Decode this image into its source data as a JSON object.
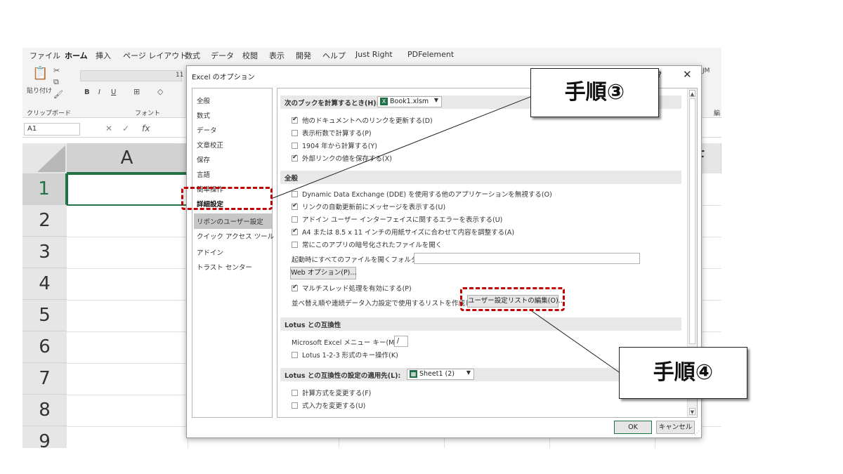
{
  "excel": {
    "menu": [
      "ファイル",
      "ホーム",
      "挿入",
      "ページ レイアウト",
      "数式",
      "データ",
      "校閲",
      "表示",
      "開発",
      "ヘルプ",
      "Just Right",
      "PDFelement"
    ],
    "active_menu": "ホーム",
    "ribbon": {
      "paste_label": "貼り付け",
      "clipboard_group": "クリップボード",
      "font_group": "フォント",
      "font_size": "11",
      "bold": "B",
      "italic": "I",
      "underline": "U",
      "right_cut_label": "JM",
      "right_group": "編"
    },
    "name_box": "A1",
    "fx": "fx",
    "columns": [
      "A",
      "F"
    ],
    "rows": [
      "1",
      "2",
      "3",
      "4",
      "5",
      "6",
      "7",
      "8",
      "9"
    ]
  },
  "dialog": {
    "title": "Excel のオプション",
    "help": "?",
    "close": "✕",
    "nav": [
      "全般",
      "数式",
      "データ",
      "文章校正",
      "保存",
      "言語",
      "簡単操作",
      "詳細設定",
      "リボンのユーザー設定",
      "クイック アクセス ツール バー",
      "アドイン",
      "トラスト センター"
    ],
    "nav_selected": "詳細設定",
    "sections": {
      "workbook": {
        "header": "次のブックを計算するとき(H):",
        "workbook_select": "Book1.xlsm",
        "options": [
          {
            "label": "他のドキュメントへのリンクを更新する(D)",
            "checked": true
          },
          {
            "label": "表示桁数で計算する(P)",
            "checked": false
          },
          {
            "label": "1904 年から計算する(Y)",
            "checked": false
          },
          {
            "label": "外部リンクの値を保存する(X)",
            "checked": true
          }
        ]
      },
      "general": {
        "header": "全般",
        "options": [
          {
            "label": "Dynamic Data Exchange (DDE) を使用する他のアプリケーションを無視する(O)",
            "checked": false
          },
          {
            "label": "リンクの自動更新前にメッセージを表示する(U)",
            "checked": true
          },
          {
            "label": "アドイン ユーザー インターフェイスに関するエラーを表示する(U)",
            "checked": false
          },
          {
            "label": "A4 または 8.5 x 11 インチの用紙サイズに合わせて内容を調整する(A)",
            "checked": true
          },
          {
            "label": "常にこのアプリの暗号化されたファイルを開く",
            "checked": false
          }
        ],
        "startup_label": "起動時にすべてのファイルを開くフォルダー(L):",
        "startup_value": "",
        "web_options_button": "Web オプション(P)...",
        "multithread": {
          "label": "マルチスレッド処理を有効にする(P)",
          "checked": true
        },
        "custom_list_label": "並べ替え順や連続データ入力設定で使用するリストを作成します:",
        "custom_list_button": "ユーザー設定リストの編集(O)..."
      },
      "lotus": {
        "header": "Lotus との互換性",
        "menu_key_label": "Microsoft Excel メニュー キー(M):",
        "menu_key_value": "/",
        "option": {
          "label": "Lotus 1-2-3 形式のキー操作(K)",
          "checked": false
        }
      },
      "lotus_sheet": {
        "header": "Lotus との互換性の設定の適用先(L):",
        "sheet_select": "Sheet1 (2)",
        "options": [
          {
            "label": "計算方式を変更する(F)",
            "checked": false
          },
          {
            "label": "式入力を変更する(U)",
            "checked": false
          }
        ]
      }
    },
    "ok": "OK",
    "cancel": "キャンセル"
  },
  "annotations": {
    "step3": "手順③",
    "step4": "手順④",
    "highlight_color": "#c00000"
  }
}
